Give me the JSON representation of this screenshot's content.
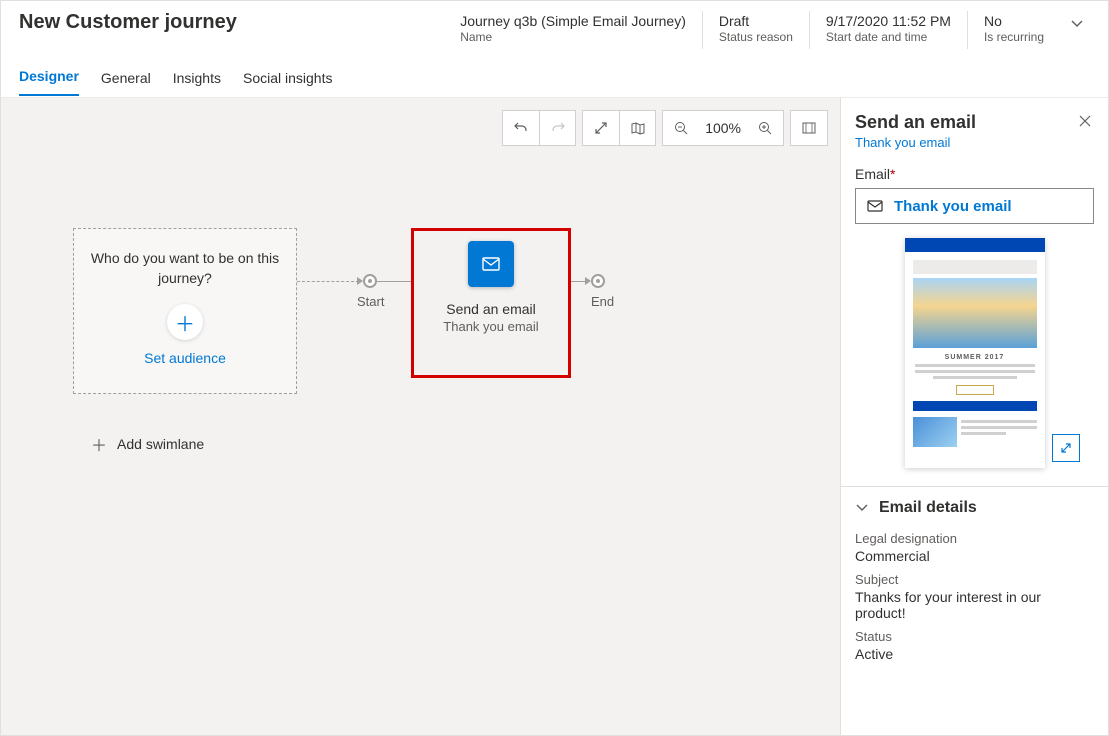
{
  "header": {
    "title": "New Customer journey",
    "meta": [
      {
        "value": "Journey q3b (Simple Email Journey)",
        "label": "Name"
      },
      {
        "value": "Draft",
        "label": "Status reason"
      },
      {
        "value": "9/17/2020 11:52 PM",
        "label": "Start date and time"
      },
      {
        "value": "No",
        "label": "Is recurring"
      }
    ]
  },
  "tabs": [
    "Designer",
    "General",
    "Insights",
    "Social insights"
  ],
  "toolbar": {
    "zoom": "100%"
  },
  "canvas": {
    "audience_question": "Who do you want to be on this journey?",
    "set_audience": "Set audience",
    "start_label": "Start",
    "end_label": "End",
    "email_tile": {
      "title": "Send an email",
      "subtitle": "Thank you email"
    },
    "add_swimlane": "Add swimlane"
  },
  "side": {
    "title": "Send an email",
    "link": "Thank you email",
    "email_label": "Email",
    "email_value": "Thank you email",
    "preview_heading": "SUMMER 2017",
    "details": {
      "heading": "Email details",
      "items": [
        {
          "label": "Legal designation",
          "value": "Commercial"
        },
        {
          "label": "Subject",
          "value": "Thanks for your interest in our product!"
        },
        {
          "label": "Status",
          "value": "Active"
        }
      ]
    }
  }
}
